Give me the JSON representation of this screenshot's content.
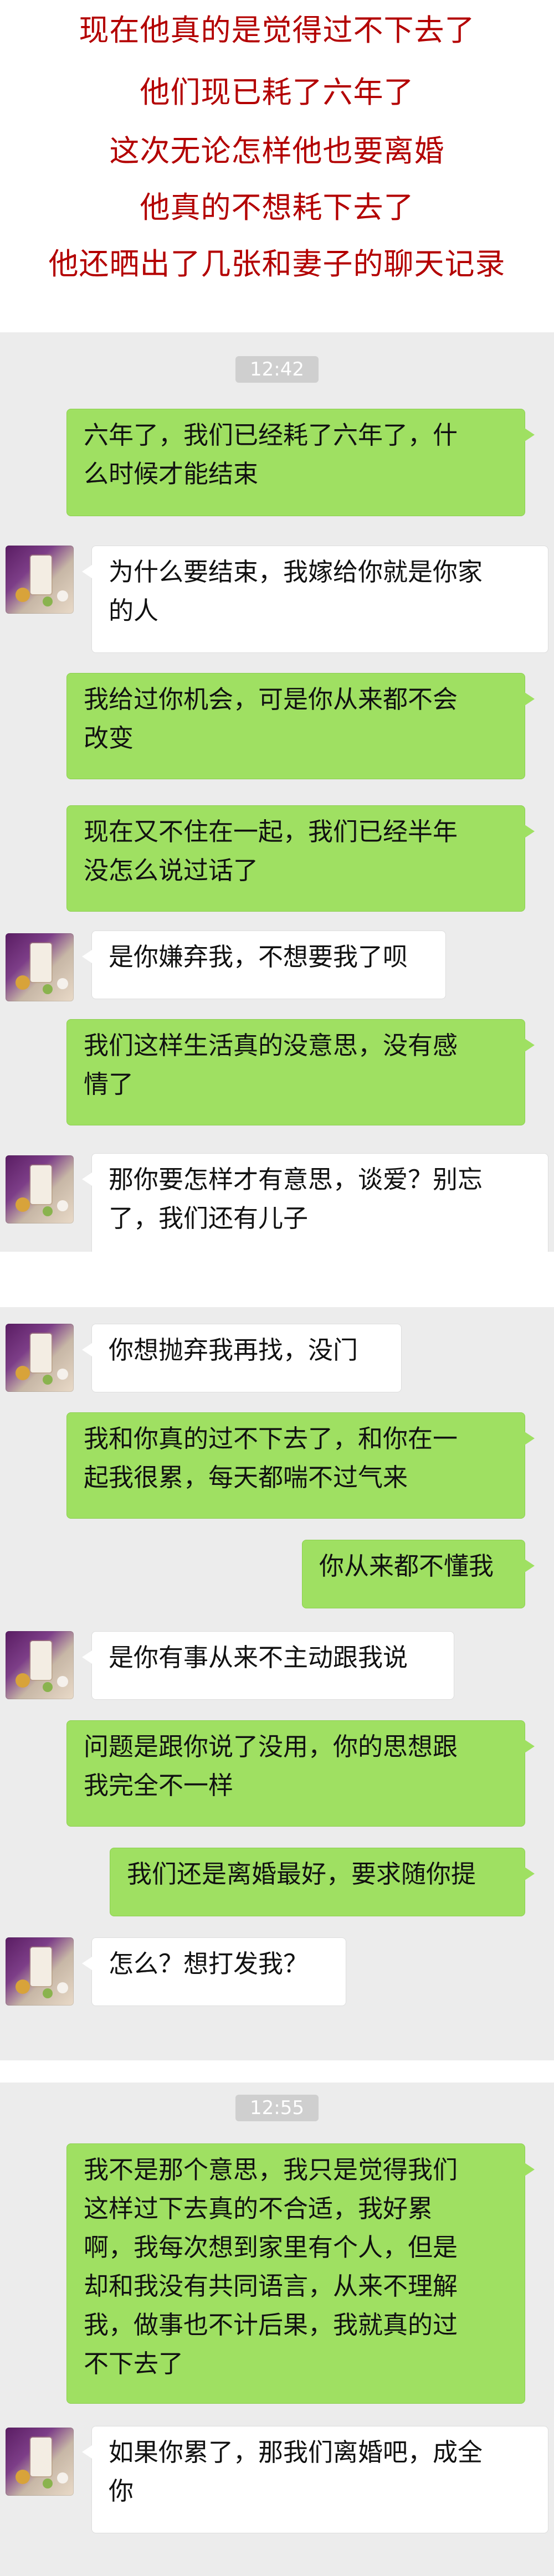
{
  "intro": {
    "lines": [
      "现在他真的是觉得过不下去了",
      "他们现已耗了六年了",
      "这次无论怎样他也要离婚",
      "他真的不想耗下去了",
      "他还晒出了几张和妻子的聊天记录"
    ]
  },
  "screenshot1": {
    "timestamp": "12:42",
    "messages": [
      {
        "side": "sent",
        "text_lines": [
          "六年了，我们已经耗了六年了，什",
          "么时候才能结束"
        ]
      },
      {
        "side": "received",
        "text_lines": [
          "为什么要结束，我嫁给你就是你家",
          "的人"
        ]
      },
      {
        "side": "sent",
        "text_lines": [
          "我给过你机会，可是你从来都不会",
          "改变"
        ]
      },
      {
        "side": "sent",
        "text_lines": [
          "现在又不住在一起，我们已经半年",
          "没怎么说过话了"
        ]
      },
      {
        "side": "received",
        "text_lines": [
          "是你嫌弃我，不想要我了呗"
        ]
      },
      {
        "side": "sent",
        "text_lines": [
          "我们这样生活真的没意思，没有感",
          "情了"
        ]
      },
      {
        "side": "received",
        "text_lines": [
          "那你要怎样才有意思，谈爱？别忘",
          "了，我们还有儿子"
        ]
      }
    ]
  },
  "screenshot2": {
    "messages": [
      {
        "side": "received",
        "text_lines": [
          "你想抛弃我再找，没门"
        ]
      },
      {
        "side": "sent",
        "text_lines": [
          "我和你真的过不下去了，和你在一",
          "起我很累，每天都喘不过气来"
        ]
      },
      {
        "side": "sent",
        "text_lines": [
          "你从来都不懂我"
        ]
      },
      {
        "side": "received",
        "text_lines": [
          "是你有事从来不主动跟我说"
        ]
      },
      {
        "side": "sent",
        "text_lines": [
          "问题是跟你说了没用，你的思想跟",
          "我完全不一样"
        ]
      },
      {
        "side": "sent",
        "text_lines": [
          "我们还是离婚最好，要求随你提"
        ]
      },
      {
        "side": "received",
        "text_lines": [
          "怎么？想打发我？"
        ]
      }
    ]
  },
  "screenshot3": {
    "timestamp": "12:55",
    "messages": [
      {
        "side": "sent",
        "text_lines": [
          "我不是那个意思，我只是觉得我们",
          "这样过下去真的不合适，我好累",
          "啊，我每次想到家里有个人，但是",
          "却和我没有共同语言，从来不理解",
          "我，做事也不计后果，我就真的过",
          "不下去了"
        ]
      },
      {
        "side": "received",
        "text_lines": [
          "如果你累了，那我们离婚吧，成全",
          "你"
        ]
      }
    ]
  },
  "colors": {
    "title_text": "#b30000",
    "chat_background": "#ececec",
    "sent_bubble": "#9fe062",
    "received_bubble": "#ffffff",
    "timestamp_badge": "#cfcfcf"
  },
  "icons": {
    "avatar": "milk-tea-avatar"
  }
}
